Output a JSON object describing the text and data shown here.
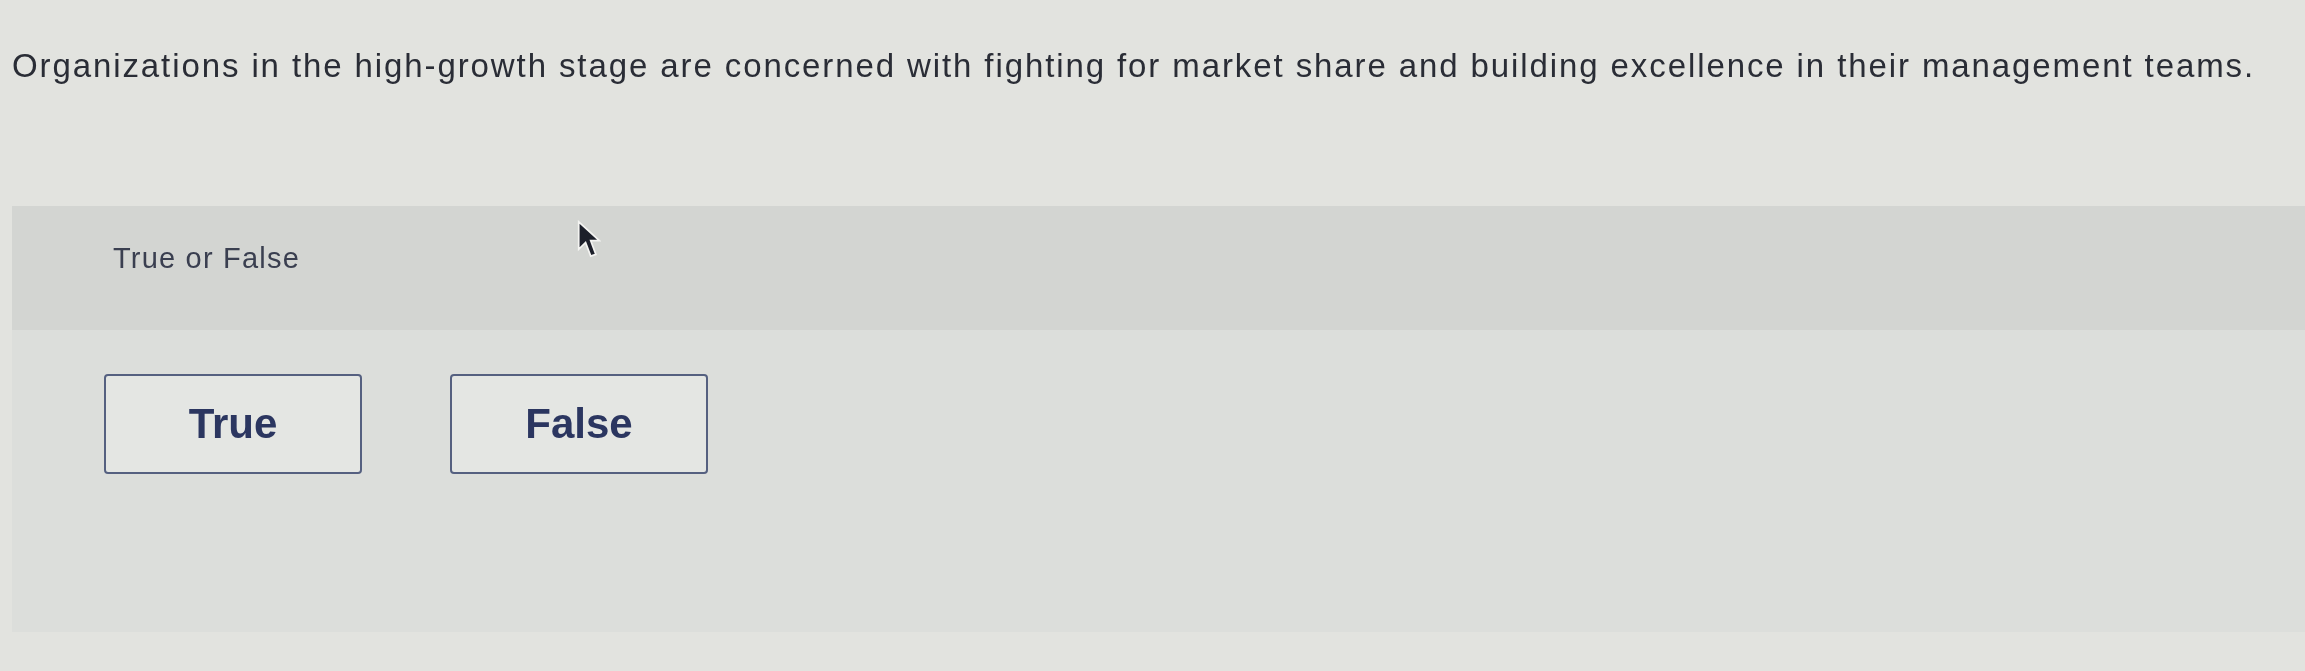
{
  "question": {
    "text": "Organizations in the high-growth stage are concerned with fighting for market share and building excellence in their management teams."
  },
  "answer_panel": {
    "prompt": "True or False",
    "options": [
      {
        "label": "True",
        "selected": false
      },
      {
        "label": "False",
        "selected": false
      }
    ]
  }
}
